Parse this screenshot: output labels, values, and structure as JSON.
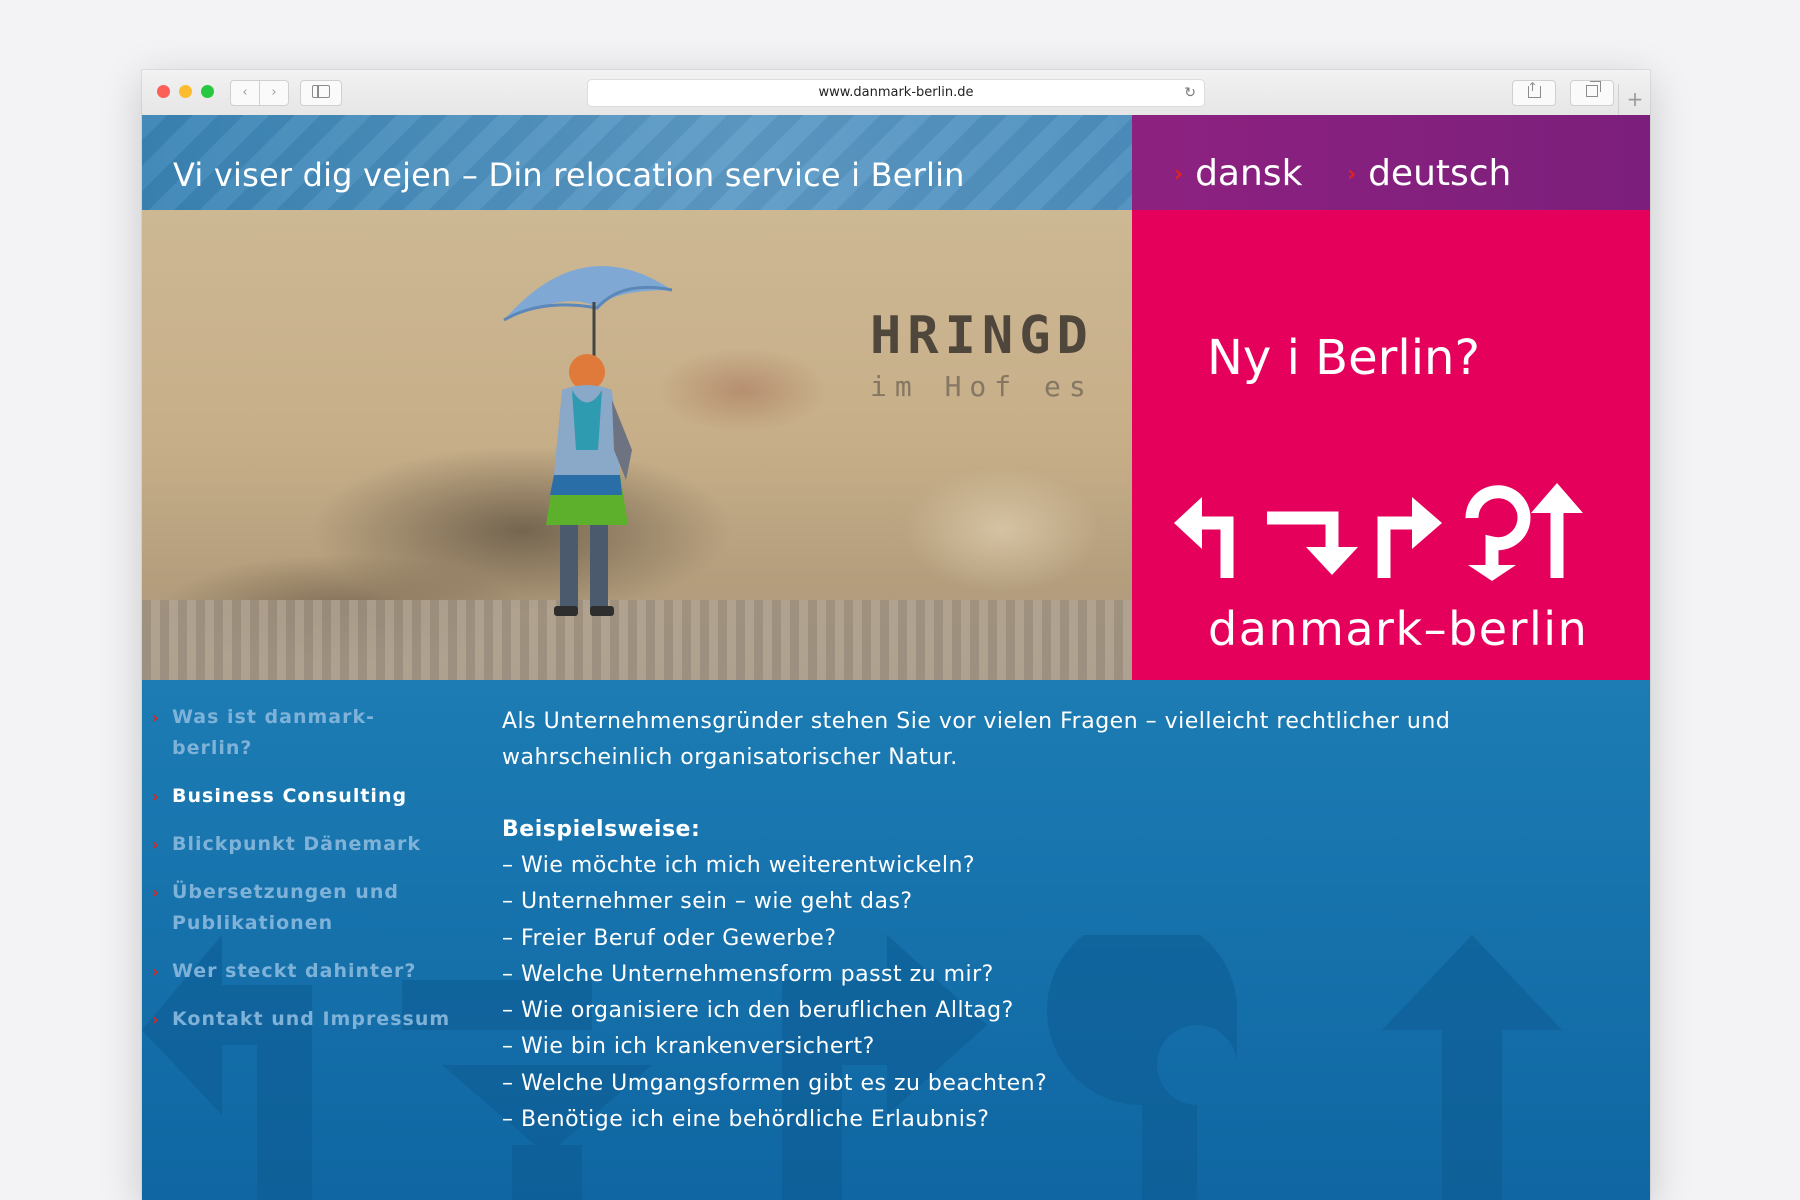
{
  "browser": {
    "url": "www.danmark-berlin.de"
  },
  "header": {
    "tagline": "Vi viser dig vejen – Din relocation service i Berlin"
  },
  "language": {
    "items": [
      "dansk",
      "deutsch"
    ]
  },
  "photo": {
    "wall_text": "HRINGD",
    "wall_subtext": "im Hof es"
  },
  "hero": {
    "question": "Ny i Berlin?",
    "brand": "danmark–berlin"
  },
  "nav": {
    "items": [
      {
        "label": "Was ist danmark-berlin?"
      },
      {
        "label": "Business Consulting"
      },
      {
        "label": "Blickpunkt Dänemark"
      },
      {
        "label": "Übersetzungen und Publikationen"
      },
      {
        "label": "Wer steckt dahinter?"
      },
      {
        "label": "Kontakt und Impressum"
      }
    ],
    "active": "Business Consulting"
  },
  "main": {
    "intro": "Als Unternehmensgründer stehen Sie vor vielen Fragen – vielleicht rechtlicher und wahrscheinlich organisatorischer Natur.",
    "examples_label": "Beispielsweise:",
    "questions": [
      "Wie möchte ich mich weiterentwickeln?",
      "Unternehmer sein – wie geht das?",
      "Freier Beruf oder Gewerbe?",
      "Welche Unternehmensform passt zu mir?",
      "Wie organisiere ich den beruflichen Alltag?",
      "Wie bin ich krankenversichert?",
      "Welche Umgangsformen gibt es zu beachten?",
      "Benötige ich eine behördliche Erlaubnis?"
    ]
  },
  "icons": {
    "nav_bullet": "chevron-right-icon",
    "logo": "direction-arrows-icon"
  },
  "colors": {
    "blue": "#1671ab",
    "magenta": "#e5005b",
    "purple": "#8d2180",
    "accent_red": "#e2231a",
    "nav_inactive": "#7fb2d8"
  }
}
